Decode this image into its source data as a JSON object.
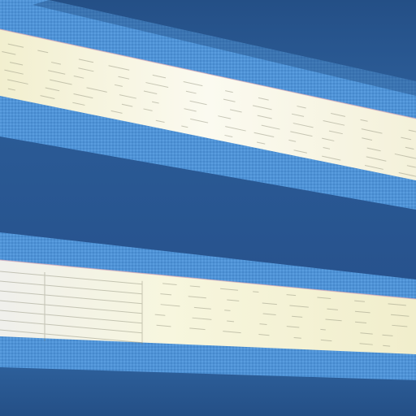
{
  "image": {
    "subject": "window-blinds",
    "visible_text": [],
    "colors": {
      "deep_band": "#2c5d98",
      "deep_band_shadow": "#244f86",
      "mesh_band": "#4f93d6",
      "mesh_band_light": "#72b2eb",
      "light_band": "#f8f7e6",
      "light_band_warm": "#f2efcf",
      "text_marks": "#8b8b76"
    }
  }
}
